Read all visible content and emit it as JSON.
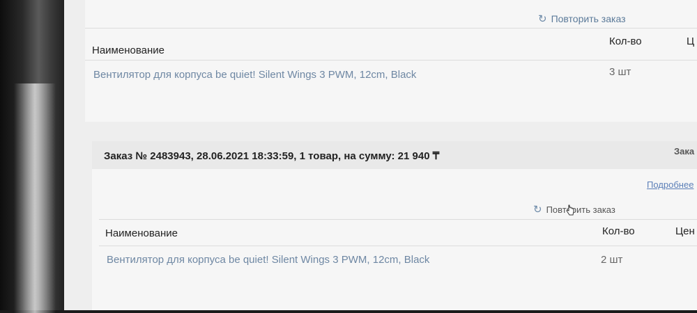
{
  "order_1": {
    "repeat_label": "Повторить заказ",
    "columns": {
      "name": "Наименование",
      "qty": "Кол-во",
      "price": "Ц"
    },
    "rows": [
      {
        "name": "Вентилятор для корпуса be quiet! Silent Wings 3 PWM, 12cm, Black",
        "qty": "3 шт"
      }
    ]
  },
  "order_2": {
    "title": "Заказ № 2483943, 28.06.2021 18:33:59, 1 товар, на сумму: 21 940 ₸",
    "status": "Зака",
    "details_link": "Подробнее",
    "repeat_label": "Повторить заказ",
    "columns": {
      "name": "Наименование",
      "qty": "Кол-во",
      "price": "Цен"
    },
    "rows": [
      {
        "name": "Вентилятор для корпуса be quiet! Silent Wings 3 PWM, 12cm, Black",
        "qty": "2 шт"
      }
    ]
  },
  "icons": {
    "repeat": "refresh-icon",
    "cursor": "hand-cursor-icon"
  }
}
